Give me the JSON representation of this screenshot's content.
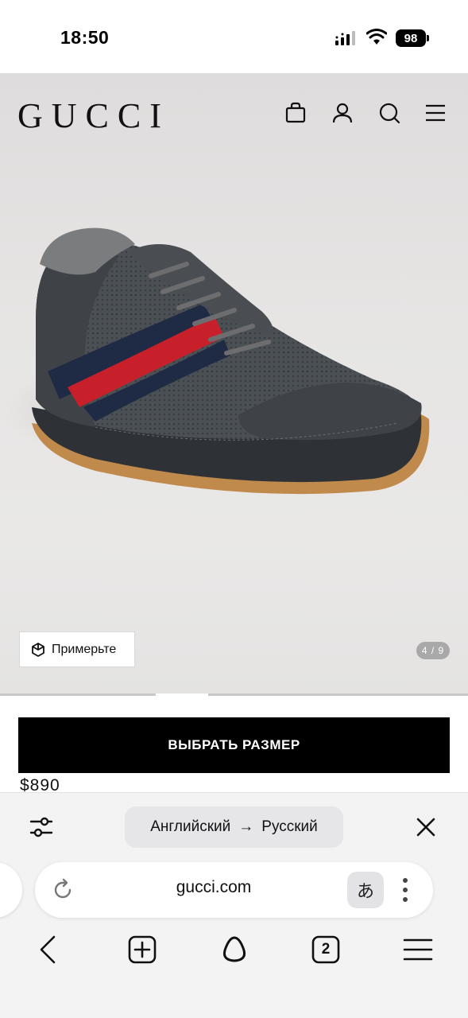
{
  "status_bar": {
    "time": "18:50",
    "battery": "98",
    "icons": [
      "cellular-signal-icon",
      "wifi-icon",
      "battery-icon"
    ]
  },
  "header": {
    "logo": "GUCCI",
    "icons": [
      "shopping-bag-icon",
      "account-icon",
      "search-icon",
      "menu-icon"
    ]
  },
  "gallery": {
    "try_on_label": "Примерьте",
    "pager": "4 / 9"
  },
  "product": {
    "select_size_label": "ВЫБРАТЬ РАЗМЕР",
    "price": "$890"
  },
  "translate_bar": {
    "from": "Английский",
    "arrow": "→",
    "to": "Русский"
  },
  "address_bar": {
    "url": "gucci.com",
    "translate_glyph": "あ"
  },
  "browser_nav": {
    "tab_count": "2",
    "icons": [
      "back-icon",
      "new-tab-icon",
      "alice-assistant-icon",
      "tabs-icon",
      "hamburger-menu-icon"
    ]
  },
  "colors": {
    "accent": "#000000",
    "stripe_red": "#c8202a",
    "stripe_navy": "#1f2a44"
  }
}
